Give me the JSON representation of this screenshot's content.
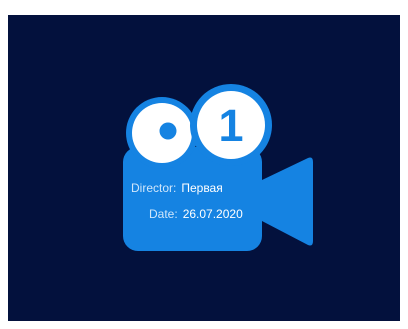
{
  "slate": {
    "number": "1",
    "director_label": "Director:",
    "director_value": "Первая",
    "date_label": "Date:",
    "date_value": "26.07.2020"
  },
  "colors": {
    "background": "#03113d",
    "camera_body": "#1583e2",
    "reel_fill": "#ffffff",
    "reel_outline": "#1583e2",
    "reel_dot": "#1583e2"
  },
  "icons": {
    "camera": "video-camera-icon",
    "reel_left": "film-reel-icon",
    "reel_right": "film-reel-icon"
  }
}
